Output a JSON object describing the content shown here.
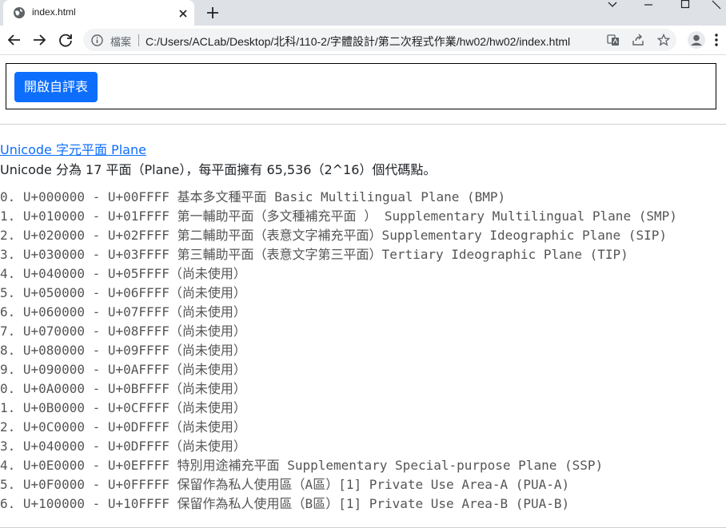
{
  "browser": {
    "tab_title": "index.html",
    "security_label": "檔案",
    "url": "C:/Users/ACLab/Desktop/北科/110-2/字體設計/第二次程式作業/hw02/hw02/index.html"
  },
  "page": {
    "eval_button_label": "開啟自評表",
    "link_text": "Unicode 字元平面 Plane",
    "intro_text": "Unicode 分為 17 平面（Plane），每平面擁有 65,536（2^16）個代碼點。",
    "planes": [
      "0. U+000000 - U+00FFFF 基本多文種平面 Basic Multilingual Plane (BMP)",
      "1. U+010000 - U+01FFFF 第一輔助平面（多文種補充平面 ） Supplementary Multilingual Plane (SMP)",
      "2. U+020000 - U+02FFFF 第二輔助平面（表意文字補充平面）Supplementary Ideographic Plane (SIP)",
      "3. U+030000 - U+03FFFF 第三輔助平面（表意文字第三平面）Tertiary Ideographic Plane (TIP)",
      "4. U+040000 - U+05FFFF（尚未使用）",
      "5. U+050000 - U+06FFFF（尚未使用）",
      "6. U+060000 - U+07FFFF（尚未使用）",
      "7. U+070000 - U+08FFFF（尚未使用）",
      "8. U+080000 - U+09FFFF（尚未使用）",
      "9. U+090000 - U+0AFFFF（尚未使用）",
      "0. U+0A0000 - U+0BFFFF（尚未使用）",
      "1. U+0B0000 - U+0CFFFF（尚未使用）",
      "2. U+0C0000 - U+0DFFFF（尚未使用）",
      "3. U+040000 - U+0DFFFF（尚未使用）",
      "4. U+0E0000 - U+0EFFFF 特別用途補充平面 Supplementary Special-purpose Plane (SSP)",
      "5. U+0F0000 - U+0FFFFF 保留作為私人使用區（A區）[1] Private Use Area-A (PUA-A)",
      "6. U+100000 - U+10FFFF 保留作為私人使用區（B區）[1] Private Use Area-B (PUA-B)"
    ]
  },
  "colors": {
    "button_primary": "#0d6efd",
    "link": "#0d6efd",
    "chrome_bg": "#dee1e6"
  },
  "icons": [
    "globe-icon",
    "close-icon",
    "plus-icon",
    "minimize-icon",
    "maximize-icon",
    "back-icon",
    "forward-icon",
    "reload-icon",
    "info-icon",
    "translate-icon",
    "share-icon",
    "star-icon",
    "profile-icon",
    "more-icon"
  ]
}
